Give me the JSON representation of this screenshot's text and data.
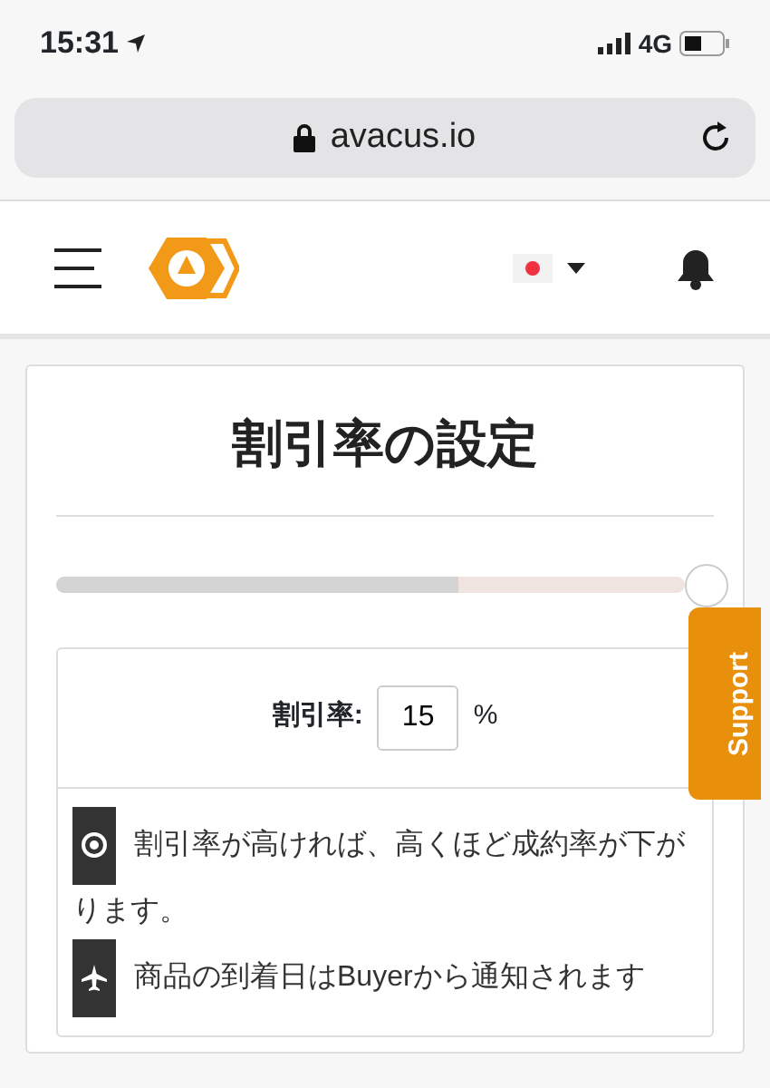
{
  "status_bar": {
    "time": "15:31",
    "network": "4G"
  },
  "browser": {
    "url": "avacus.io"
  },
  "card": {
    "title": "割引率の設定",
    "slider": {
      "level": 0.64
    },
    "rate": {
      "label": "割引率:",
      "value": "15",
      "unit": "%"
    },
    "notes": [
      {
        "kind": "target",
        "text": "割引率が高ければ、高くほど成約率が下がります。"
      },
      {
        "kind": "plane",
        "text": "商品の到着日はBuyerから通知されます"
      }
    ]
  },
  "support_tab": {
    "label": "Support"
  }
}
